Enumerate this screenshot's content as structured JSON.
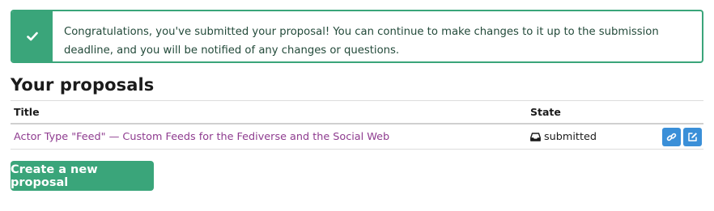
{
  "alert": {
    "icon": "check-icon",
    "message": "Congratulations, you've submitted your proposal! You can continue to make changes to it up to the submission deadline, and you will be notified of any changes or questions."
  },
  "proposals": {
    "heading": "Your proposals",
    "columns": {
      "title": "Title",
      "state": "State"
    },
    "rows": [
      {
        "title": "Actor Type \"Feed\" — Custom Feeds for the Fediverse and the Social Web",
        "state_icon": "inbox-icon",
        "state": "submitted",
        "actions": [
          "link-icon",
          "edit-icon"
        ]
      }
    ]
  },
  "actions": {
    "create_label": "Create a new proposal"
  },
  "colors": {
    "success": "#3aa57a",
    "link": "#8e3b8f",
    "action_button": "#3a8fd8"
  }
}
